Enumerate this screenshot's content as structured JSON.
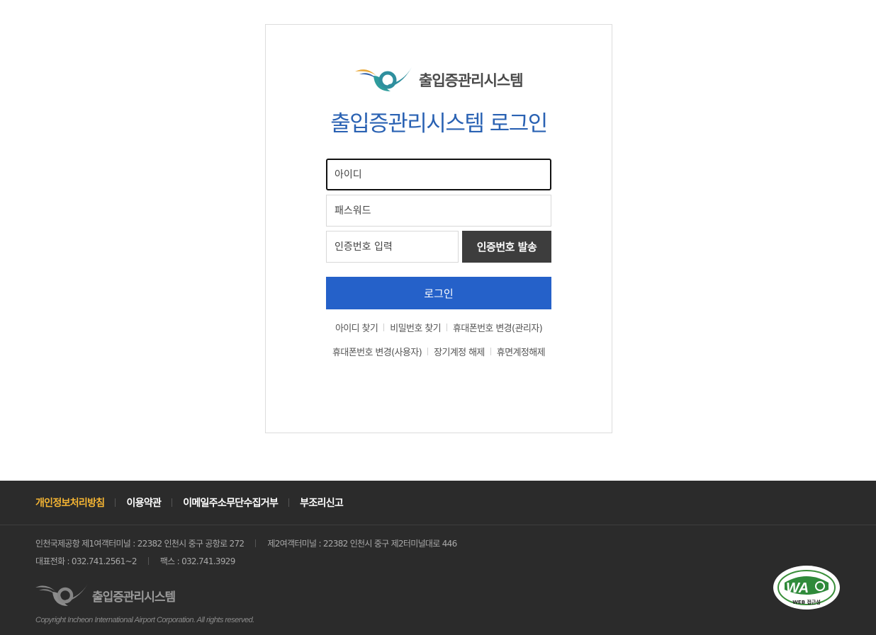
{
  "card": {
    "logo_text": "출입증관리시스템",
    "title": "출입증관리시스템 로그인",
    "id_placeholder": "아이디",
    "password_placeholder": "패스워드",
    "code_placeholder": "인증번호 입력",
    "send_code_label": "인증번호 발송",
    "login_label": "로그인",
    "links_row1": [
      "아이디 찾기",
      "비밀번호 찾기",
      "휴대폰번호 변경(관리자)"
    ],
    "links_row2": [
      "휴대폰번호 변경(사용자)",
      "장기계정 해제",
      "휴면계정해제"
    ]
  },
  "footer": {
    "nav": [
      "개인정보처리방침",
      "이용약관",
      "이메일주소무단수집거부",
      "부조리신고"
    ],
    "address_t1": "인천국제공항 제1여객터미널 : 22382 인천시 중구 공항로 272",
    "address_t2": "제2여객터미널 : 22382 인천시 중구 제2터미널대로 446",
    "phone": "대표전화 : 032.741.2561~2",
    "fax": "팩스 : 032.741.3929",
    "logo_text": "출입증관리시스템",
    "copyright": "Copyright Incheon International Airport Corporation. All rights reserved.",
    "badge_text": "WA",
    "badge_caption": "WEB 접근성"
  },
  "colors": {
    "title_blue": "#2a62b3",
    "login_button": "#2561c9",
    "send_code_button": "#3d3d3d",
    "footer_bg": "#2b2b2b",
    "footer_highlight": "#f5b533"
  },
  "icons": {
    "logo": "airport-swoosh-logo-icon",
    "badge": "web-accessibility-badge-icon"
  }
}
